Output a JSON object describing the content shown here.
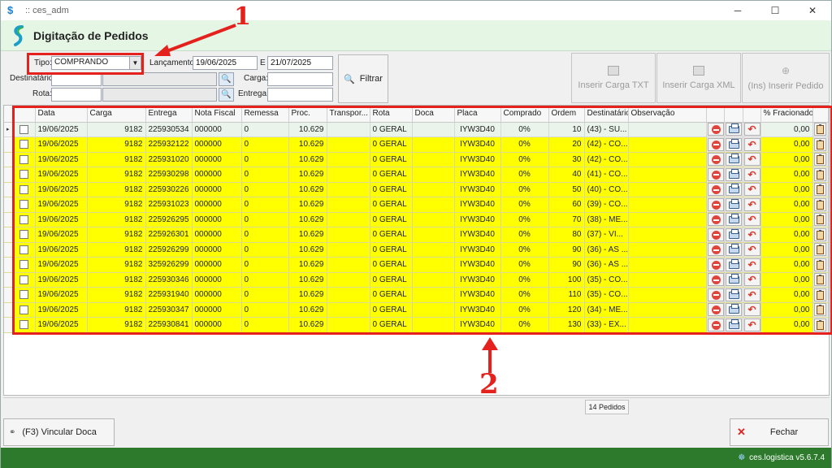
{
  "window": {
    "title": ":: ces_adm",
    "minimize": "─",
    "maximize": "☐",
    "close": "✕"
  },
  "header": {
    "title": "Digitação de Pedidos"
  },
  "filters": {
    "tipo_label": "Tipo:",
    "tipo_value": "COMPRANDO",
    "lancamento_label": "Lançamento:",
    "lancamento_from": "19/06/2025",
    "e_label": "E",
    "lancamento_to": "21/07/2025",
    "destinatario_label": "Destinatário:",
    "destinatario_value": "",
    "destinatario_desc": "",
    "carga_label": "Carga:",
    "carga_value": "",
    "rota_label": "Rota:",
    "rota_value": "",
    "rota_desc": "",
    "entrega_label": "Entrega:",
    "entrega_value": "",
    "filtrar_label": "Filtrar"
  },
  "actions": {
    "inserir_txt": "Inserir Carga TXT",
    "inserir_xml": "Inserir Carga XML",
    "inserir_pedido": "(Ins) Inserir Pedido"
  },
  "columns": [
    "Data",
    "Carga",
    "Entrega",
    "Nota Fiscal",
    "Remessa",
    "Proc.",
    "Transpor...",
    "Rota",
    "Doca",
    "Placa",
    "Comprado",
    "Ordem",
    "Destinatário",
    "Observação",
    "",
    "",
    "",
    "% Fracionado",
    ""
  ],
  "rows": [
    {
      "data": "19/06/2025",
      "carga": "9182",
      "entrega": "225930534",
      "nf": "000000",
      "remessa": "0",
      "proc": "10.629",
      "transp": "",
      "rota": "0 GERAL",
      "doca": "",
      "placa": "IYW3D40",
      "comprado": "0%",
      "ordem": "10",
      "dest": "(43) - SU...",
      "obs": "",
      "frac": "0,00"
    },
    {
      "data": "19/06/2025",
      "carga": "9182",
      "entrega": "225932122",
      "nf": "000000",
      "remessa": "0",
      "proc": "10.629",
      "transp": "",
      "rota": "0 GERAL",
      "doca": "",
      "placa": "IYW3D40",
      "comprado": "0%",
      "ordem": "20",
      "dest": "(42) - CO...",
      "obs": "",
      "frac": "0,00"
    },
    {
      "data": "19/06/2025",
      "carga": "9182",
      "entrega": "225931020",
      "nf": "000000",
      "remessa": "0",
      "proc": "10.629",
      "transp": "",
      "rota": "0 GERAL",
      "doca": "",
      "placa": "IYW3D40",
      "comprado": "0%",
      "ordem": "30",
      "dest": "(42) - CO...",
      "obs": "",
      "frac": "0,00"
    },
    {
      "data": "19/06/2025",
      "carga": "9182",
      "entrega": "225930298",
      "nf": "000000",
      "remessa": "0",
      "proc": "10.629",
      "transp": "",
      "rota": "0 GERAL",
      "doca": "",
      "placa": "IYW3D40",
      "comprado": "0%",
      "ordem": "40",
      "dest": "(41) - CO...",
      "obs": "",
      "frac": "0,00"
    },
    {
      "data": "19/06/2025",
      "carga": "9182",
      "entrega": "225930226",
      "nf": "000000",
      "remessa": "0",
      "proc": "10.629",
      "transp": "",
      "rota": "0 GERAL",
      "doca": "",
      "placa": "IYW3D40",
      "comprado": "0%",
      "ordem": "50",
      "dest": "(40) - CO...",
      "obs": "",
      "frac": "0,00"
    },
    {
      "data": "19/06/2025",
      "carga": "9182",
      "entrega": "225931023",
      "nf": "000000",
      "remessa": "0",
      "proc": "10.629",
      "transp": "",
      "rota": "0 GERAL",
      "doca": "",
      "placa": "IYW3D40",
      "comprado": "0%",
      "ordem": "60",
      "dest": "(39) - CO...",
      "obs": "",
      "frac": "0,00"
    },
    {
      "data": "19/06/2025",
      "carga": "9182",
      "entrega": "225926295",
      "nf": "000000",
      "remessa": "0",
      "proc": "10.629",
      "transp": "",
      "rota": "0 GERAL",
      "doca": "",
      "placa": "IYW3D40",
      "comprado": "0%",
      "ordem": "70",
      "dest": "(38) - ME...",
      "obs": "",
      "frac": "0,00"
    },
    {
      "data": "19/06/2025",
      "carga": "9182",
      "entrega": "225926301",
      "nf": "000000",
      "remessa": "0",
      "proc": "10.629",
      "transp": "",
      "rota": "0 GERAL",
      "doca": "",
      "placa": "IYW3D40",
      "comprado": "0%",
      "ordem": "80",
      "dest": "(37) - VI...",
      "obs": "",
      "frac": "0,00"
    },
    {
      "data": "19/06/2025",
      "carga": "9182",
      "entrega": "225926299",
      "nf": "000000",
      "remessa": "0",
      "proc": "10.629",
      "transp": "",
      "rota": "0 GERAL",
      "doca": "",
      "placa": "IYW3D40",
      "comprado": "0%",
      "ordem": "90",
      "dest": "(36) - AS ...",
      "obs": "",
      "frac": "0,00"
    },
    {
      "data": "19/06/2025",
      "carga": "9182",
      "entrega": "325926299",
      "nf": "000000",
      "remessa": "0",
      "proc": "10.629",
      "transp": "",
      "rota": "0 GERAL",
      "doca": "",
      "placa": "IYW3D40",
      "comprado": "0%",
      "ordem": "90",
      "dest": "(36) - AS ...",
      "obs": "",
      "frac": "0,00"
    },
    {
      "data": "19/06/2025",
      "carga": "9182",
      "entrega": "225930346",
      "nf": "000000",
      "remessa": "0",
      "proc": "10.629",
      "transp": "",
      "rota": "0 GERAL",
      "doca": "",
      "placa": "IYW3D40",
      "comprado": "0%",
      "ordem": "100",
      "dest": "(35) - CO...",
      "obs": "",
      "frac": "0,00"
    },
    {
      "data": "19/06/2025",
      "carga": "9182",
      "entrega": "225931940",
      "nf": "000000",
      "remessa": "0",
      "proc": "10.629",
      "transp": "",
      "rota": "0 GERAL",
      "doca": "",
      "placa": "IYW3D40",
      "comprado": "0%",
      "ordem": "110",
      "dest": "(35) - CO...",
      "obs": "",
      "frac": "0,00"
    },
    {
      "data": "19/06/2025",
      "carga": "9182",
      "entrega": "225930347",
      "nf": "000000",
      "remessa": "0",
      "proc": "10.629",
      "transp": "",
      "rota": "0 GERAL",
      "doca": "",
      "placa": "IYW3D40",
      "comprado": "0%",
      "ordem": "120",
      "dest": "(34) - ME...",
      "obs": "",
      "frac": "0,00"
    },
    {
      "data": "19/06/2025",
      "carga": "9182",
      "entrega": "225930841",
      "nf": "000000",
      "remessa": "0",
      "proc": "10.629",
      "transp": "",
      "rota": "0 GERAL",
      "doca": "",
      "placa": "IYW3D40",
      "comprado": "0%",
      "ordem": "130",
      "dest": "(33) - EX...",
      "obs": "",
      "frac": "0,00"
    }
  ],
  "status": {
    "count": "14 Pedidos"
  },
  "bottom": {
    "vincular": "(F3) Vincular Doca",
    "fechar": "Fechar"
  },
  "footer": {
    "version": "ces.logistica v5.6.7.4"
  },
  "annotations": {
    "one": "1",
    "two": "2",
    "color": "#e4211c"
  },
  "colors": {
    "row_highlight": "#ffff00",
    "header_bg": "#e5f6e5",
    "footer_bg": "#2d7a2d"
  }
}
